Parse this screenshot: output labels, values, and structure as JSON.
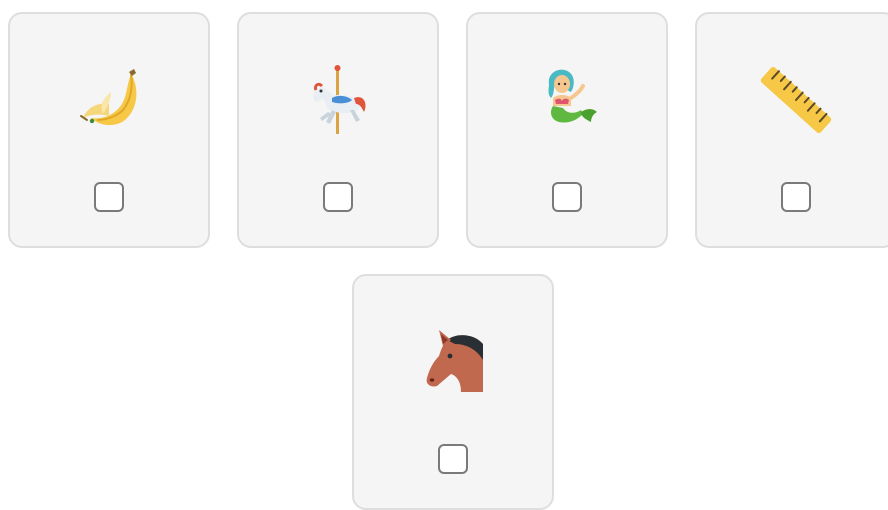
{
  "options": [
    {
      "name": "banana",
      "icon": "banana-icon",
      "checked": false
    },
    {
      "name": "carousel-horse",
      "icon": "carousel-horse-icon",
      "checked": false
    },
    {
      "name": "mermaid",
      "icon": "mermaid-icon",
      "checked": false
    },
    {
      "name": "ruler",
      "icon": "ruler-icon",
      "checked": false
    },
    {
      "name": "horse-face",
      "icon": "horse-face-icon",
      "checked": false
    }
  ]
}
